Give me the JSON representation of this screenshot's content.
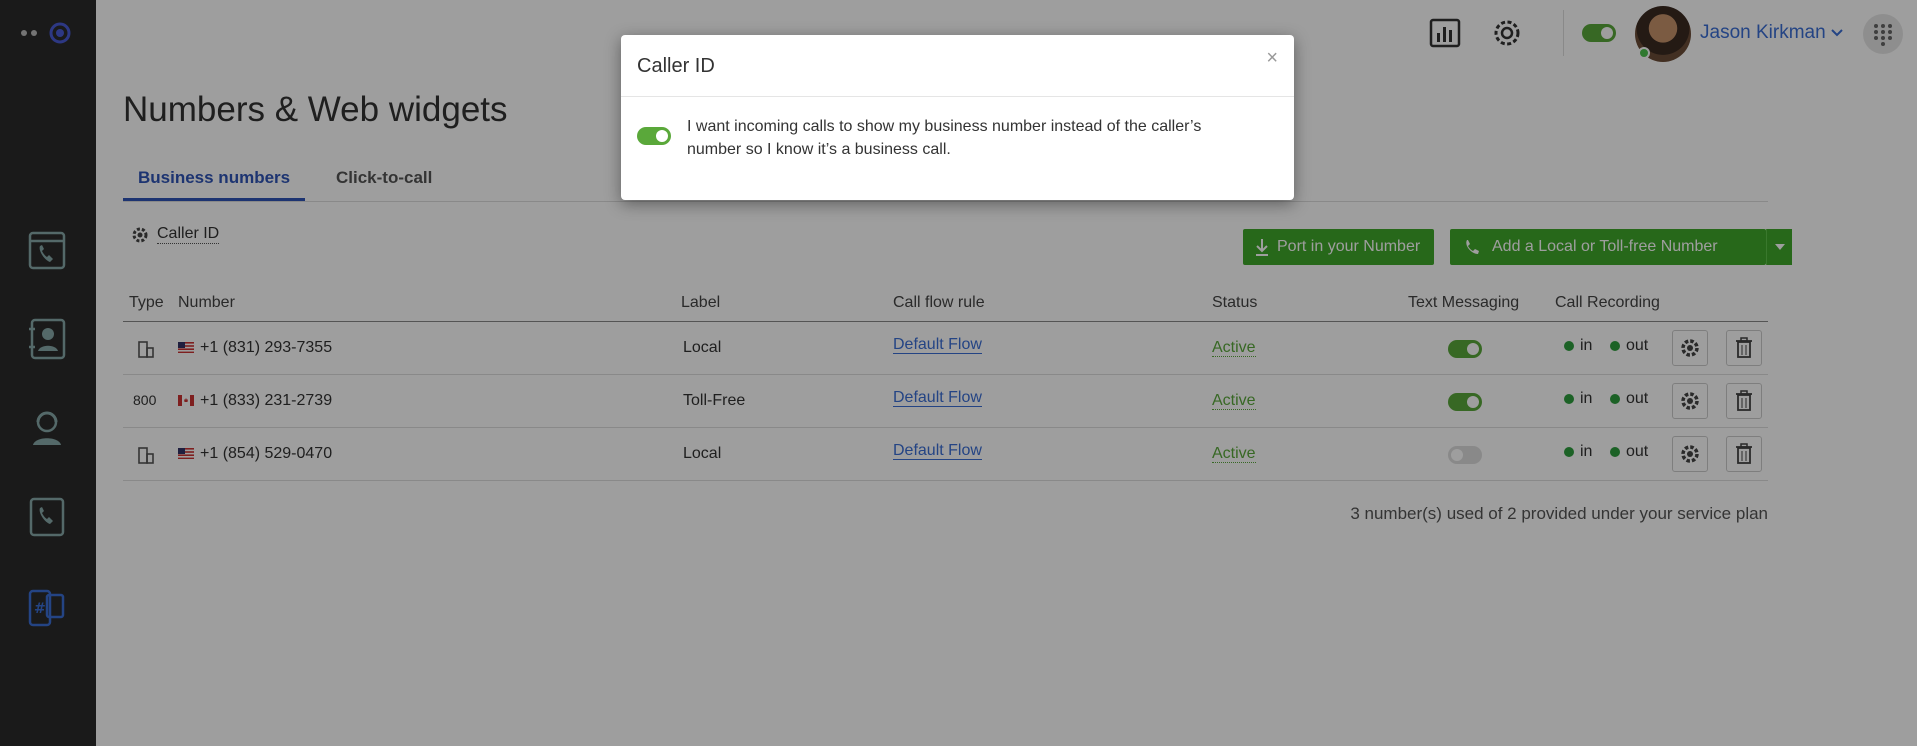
{
  "user": {
    "name": "Jason Kirkman"
  },
  "page": {
    "title": "Numbers & Web widgets"
  },
  "tabs": [
    {
      "label": "Business numbers"
    },
    {
      "label": "Click-to-call"
    }
  ],
  "toolbar": {
    "caller_id_label": "Caller ID",
    "port_label": "Port in your Number",
    "add_label": "Add a Local or Toll-free Number"
  },
  "table": {
    "headers": [
      "Type",
      "Number",
      "Label",
      "Call flow rule",
      "Status",
      "Text Messaging",
      "Call Recording"
    ],
    "rows": [
      {
        "type": "",
        "number": "+1 (831) 293-7355",
        "label": "Local",
        "flow": "Default Flow",
        "status": "Active",
        "texting": true,
        "rec_in": "in",
        "rec_out": "out"
      },
      {
        "type": "800",
        "number": "+1 (833) 231-2739",
        "label": "Toll-Free",
        "flow": "Default Flow",
        "status": "Active",
        "texting": true,
        "rec_in": "in",
        "rec_out": "out"
      },
      {
        "type": "",
        "number": "+1 (854) 529-0470",
        "label": "Local",
        "flow": "Default Flow",
        "status": "Active",
        "texting": false,
        "rec_in": "in",
        "rec_out": "out"
      }
    ]
  },
  "plan_note": "3 number(s) used of 2 provided under your service plan",
  "modal": {
    "title": "Caller ID",
    "close": "×",
    "text": "I want incoming calls to show my business number instead of the caller’s number so I know it’s a business call.",
    "enabled": true
  },
  "colors": {
    "accent": "#3fa82a",
    "link": "#3b6fd6",
    "sidebar": "#2b2b2b",
    "tab_active": "#2f55b7"
  }
}
